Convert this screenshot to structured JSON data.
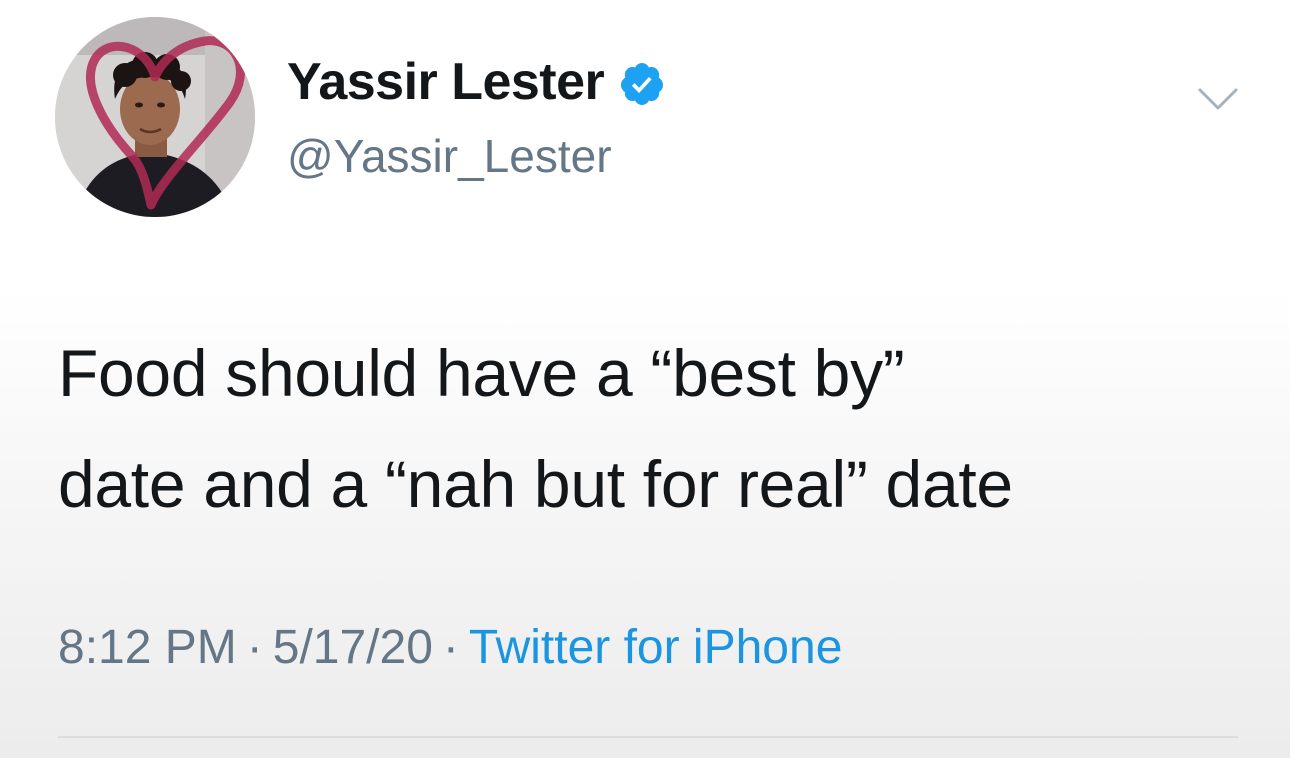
{
  "author": {
    "name": "Yassir Lester",
    "handle": "@Yassir_Lester",
    "verified": true,
    "avatar_icon": "profile-photo-with-heart"
  },
  "tweet": {
    "text_lines": [
      "Food should have a “best by”",
      "date and a “nah but for real” date"
    ]
  },
  "meta": {
    "time": "8:12 PM",
    "separator": "·",
    "date": "5/17/20",
    "source": "Twitter for iPhone"
  },
  "colors": {
    "primary_text": "#14171a",
    "secondary_text": "#657786",
    "link": "#1b95e0",
    "verified_badge": "#1da1f2"
  },
  "icons": {
    "menu": "chevron-down-icon",
    "verified": "verified-badge-icon"
  }
}
